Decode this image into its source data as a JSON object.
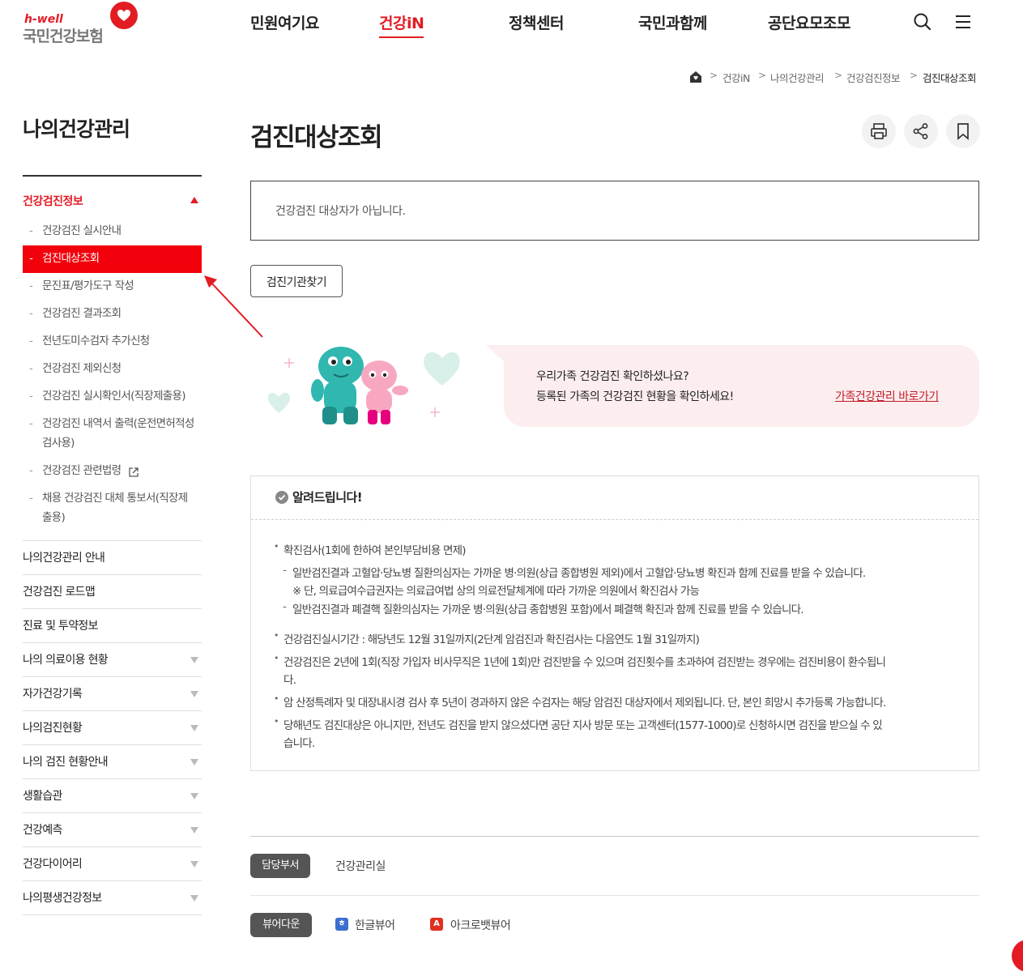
{
  "header": {
    "logo_sub": "h-well",
    "logo_main": "국민건강보험",
    "nav": [
      "민원여기요",
      "건강iN",
      "정책센터",
      "국민과함께",
      "공단요모조모"
    ],
    "active_nav": "건강iN"
  },
  "breadcrumb": [
    "건강iN",
    "나의건강관리",
    "건강검진정보",
    "검진대상조회"
  ],
  "sidebar": {
    "title": "나의건강관리",
    "active_section": "건강검진정보",
    "sub_items": [
      "건강검진 실시안내",
      "검진대상조회",
      "문진표/평가도구 작성",
      "건강검진 결과조회",
      "전년도미수검자 추가신청",
      "건강검진 제외신청",
      "건강검진 실시확인서(직장제출용)",
      "건강검진 내역서 출력(운전면허적성",
      "검사용)",
      "건강검진 관련법령",
      "채용 건강검진 대체 통보서(직장제",
      "출용)"
    ],
    "menus": [
      "나의건강관리 안내",
      "건강검진 로드맵",
      "진료 및 투약정보",
      "나의 의료이용 현황",
      "자가건강기록",
      "나의검진현황",
      "나의 검진 현황안내",
      "생활습관",
      "건강예측",
      "건강다이어리",
      "나의평생건강정보"
    ]
  },
  "main": {
    "title": "검진대상조회",
    "notice": "건강검진 대상자가 아닙니다.",
    "find_button": "검진기관찾기",
    "banner": {
      "line1": "우리가족 건강검진 확인하셨나요?",
      "line2": "등록된 가족의 건강검진 현황을 확인하세요!",
      "link": "가족건강관리 바로가기"
    },
    "info": {
      "title": "알려드립니다!",
      "lines": [
        "확진검사(1회에 한하여 본인부담비용 면제)",
        "일반검진결과 고혈압·당뇨병 질환의심자는 가까운 병·의원(상급 종합병원 제외)에서 고혈압·당뇨병 확진과 함께 진료를 받을 수 있습니다.",
        "※ 단, 의료급여수급권자는 의료급여법 상의 의료전달체계에 따라 가까운 의원에서 확진검사 가능",
        "일반검진결과 폐결핵 질환의심자는 가까운 병·의원(상급 종합병원 포함)에서 폐결핵 확진과 함께 진료를 받을 수 있습니다.",
        "건강검진실시기간 : 해당년도 12월 31일까지(2단계 암검진과 확진검사는 다음연도 1월 31일까지)",
        "건강검진은 2년에 1회(직장 가입자 비사무직은 1년에 1회)만 검진받을 수 있으며 검진횟수를 초과하여 검진받는 경우에는 검진비용이 환수됩니",
        "다.",
        "암 산정특례자 및 대장내시경 검사 후 5년이 경과하지 않은 수검자는 해당 암검진 대상자에서 제외됩니다. 단, 본인 희망시 추가등록 가능합니다.",
        "당해년도 검진대상은 아니지만, 전년도 검진을 받지 않으셨다면 공단 지사 방문 또는 고객센터(1577-1000)로 신청하시면 검진을 받으실 수 있",
        "습니다."
      ]
    },
    "dept_label": "담당부서",
    "dept_value": "건강관리실",
    "viewer_label": "뷰어다운",
    "viewers": [
      "한글뷰어",
      "아크로뱃뷰어"
    ]
  },
  "colors": {
    "accent": "#e31b23",
    "selected_bg": "#f2000b",
    "banner_bg": "#fcedee"
  }
}
